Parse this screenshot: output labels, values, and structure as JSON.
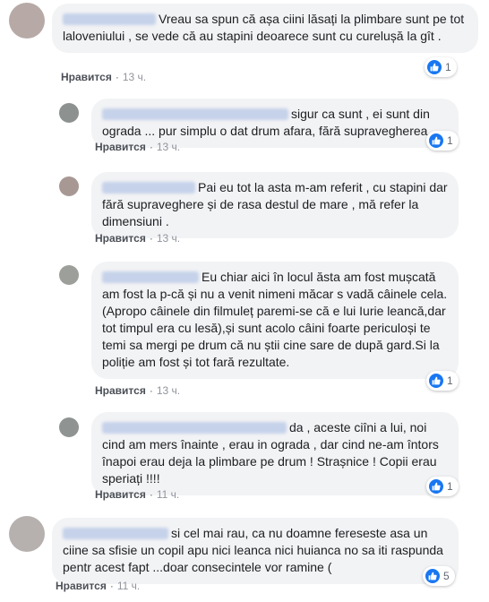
{
  "comments": [
    {
      "text": "Vreau sa spun că așa ciini lăsați la plimbare sunt pe tot laloveniului , se vede că au stapini deoarece sunt cu curelușă la gît .",
      "like": "Нравится",
      "time": "13 ч.",
      "reactions": "1",
      "reply": false
    },
    {
      "text": "sigur ca sunt , ei sunt din ograda ... pur simplu o dat drum afara, fără supravegherea .",
      "like": "Нравится",
      "time": "13 ч.",
      "reactions": "1",
      "reply": true
    },
    {
      "text": "Pai eu tot la asta m-am referit , cu stapini dar fără supraveghere și de rasa destul de mare , mă refer la dimensiuni .",
      "like": "Нравится",
      "time": "13 ч.",
      "reactions": "",
      "reply": true
    },
    {
      "text": "Eu chiar aici în locul ăsta am fost mușcată am fost la p-că și nu a venit nimeni măcar s vadă câinele cela.\n(Apropo câinele din filmuleț paremi-se că e lui Iurie leancă,dar tot timpul era cu lesă),și sunt acolo câini foarte periculoși te temi sa mergi pe drum că nu știi cine sare de după gard.Si la poliție am fost și tot fară rezultate.",
      "like": "Нравится",
      "time": "13 ч.",
      "reactions": "1",
      "reply": true
    },
    {
      "text": "da , aceste ciîni a lui, noi cind am mers înainte , erau in ograda , dar cind ne-am întors înapoi erau deja la plimbare pe drum ! Strașnice ! Copii erau speriați !!!!",
      "like": "Нравится",
      "time": "11 ч.",
      "reactions": "1",
      "reply": true
    },
    {
      "text": "si cel mai rau, ca nu doamne fereseste asa un ciine sa sfisie un copil apu nici leanca nici huianca no sa iti raspunda pentr acest fapt ...doar consecintele vor ramine (",
      "like": "Нравится",
      "time": "11 ч.",
      "reactions": "5",
      "reply": false
    }
  ],
  "colors": {
    "bubble": "#f2f3f5",
    "like_blue": "#1877f2",
    "meta_gray": "#606770"
  },
  "icons": {
    "reaction": "thumbs-up-icon"
  }
}
